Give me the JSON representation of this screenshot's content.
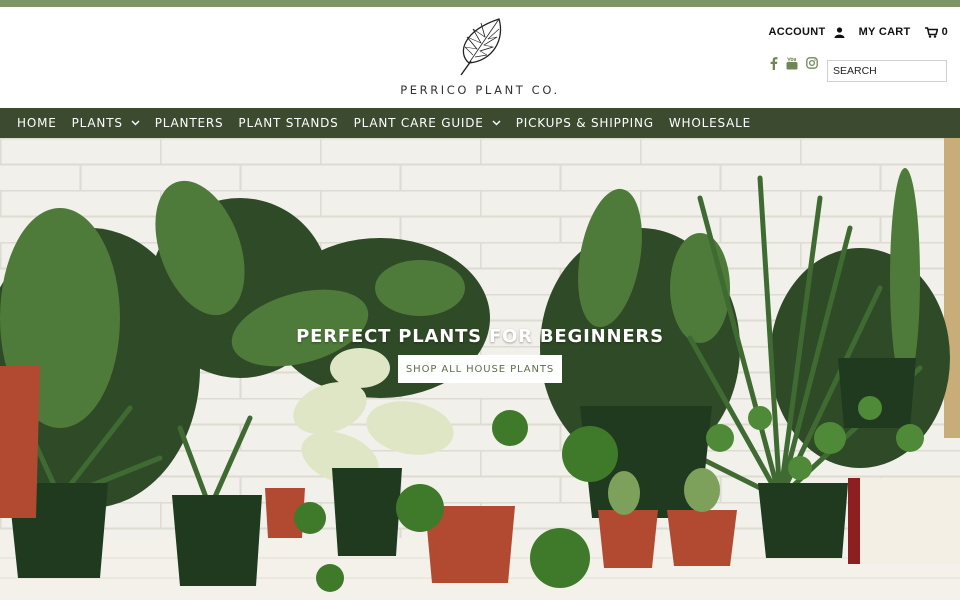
{
  "brand": {
    "name": "PERRICO PLANT CO."
  },
  "header": {
    "account_label": "ACCOUNT",
    "cart_label": "MY CART",
    "cart_count": "0",
    "search_placeholder": "SEARCH",
    "social_icons": [
      "facebook-icon",
      "youtube-icon",
      "instagram-icon"
    ]
  },
  "nav": {
    "items": [
      {
        "label": "HOME",
        "dropdown": false
      },
      {
        "label": "PLANTS",
        "dropdown": true
      },
      {
        "label": "PLANTERS",
        "dropdown": false
      },
      {
        "label": "PLANT STANDS",
        "dropdown": false
      },
      {
        "label": "PLANT CARE GUIDE",
        "dropdown": true
      },
      {
        "label": "PICKUPS & SHIPPING",
        "dropdown": false
      },
      {
        "label": "WHOLESALE",
        "dropdown": false
      }
    ]
  },
  "hero": {
    "title": "PERFECT PLANTS FOR BEGINNERS",
    "button_label": "SHOP ALL HOUSE PLANTS"
  },
  "colors": {
    "accent_strip": "#7f9467",
    "nav_bg": "#3c4a30",
    "button_text": "#5d6f4a"
  }
}
